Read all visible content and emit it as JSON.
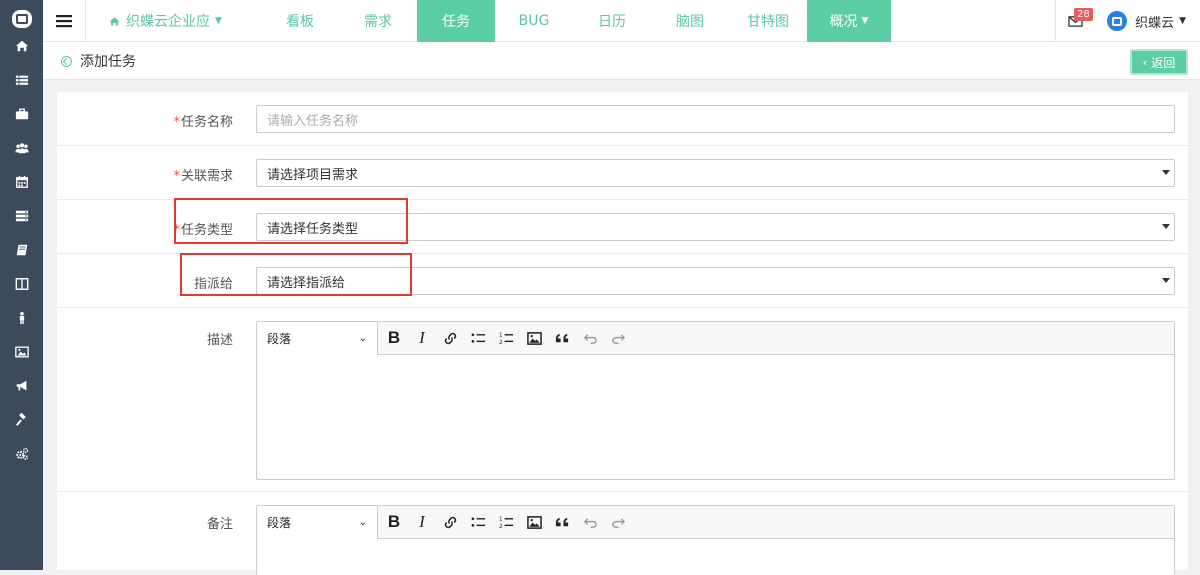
{
  "app": {
    "project_name": "织蝶云企业应",
    "user_name": "织蝶云",
    "mail_count": "28"
  },
  "nav": {
    "tabs": [
      {
        "label": "看板",
        "active": false
      },
      {
        "label": "需求",
        "active": false
      },
      {
        "label": "任务",
        "active": true
      },
      {
        "label": "BUG",
        "active": false
      },
      {
        "label": "日历",
        "active": false
      },
      {
        "label": "脑图",
        "active": false
      },
      {
        "label": "甘特图",
        "active": false
      },
      {
        "label": "概况",
        "active": true
      }
    ]
  },
  "sidebar": {
    "icons": [
      "home-icon",
      "list-icon",
      "briefcase-icon",
      "users-icon",
      "calendar-icon",
      "server-icon",
      "book-icon",
      "columns-icon",
      "person-icon",
      "image-icon",
      "bullhorn-icon",
      "gavel-icon",
      "cogs-icon"
    ]
  },
  "page": {
    "title": "添加任务",
    "back_label": "返回"
  },
  "form": {
    "task_name": {
      "label": "任务名称",
      "required": "*",
      "placeholder": "请输入任务名称"
    },
    "requirement": {
      "label": "关联需求",
      "required": "*",
      "value": "请选择项目需求"
    },
    "task_type": {
      "label": "任务类型",
      "required": "*",
      "value": "请选择任务类型"
    },
    "assignee": {
      "label": "指派给",
      "value": "请选择指派给"
    },
    "description": {
      "label": "描述",
      "paragraph": "段落"
    },
    "notes": {
      "label": "备注",
      "paragraph": "段落"
    }
  },
  "colors": {
    "accent": "#5bcea4",
    "sidebar": "#3d4a5c",
    "required": "#e8524a",
    "highlight": "#e53935"
  }
}
